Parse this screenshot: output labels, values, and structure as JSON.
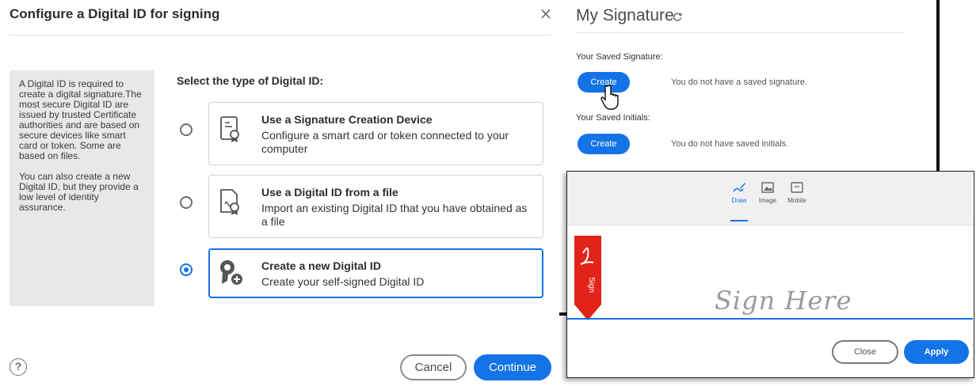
{
  "dialog": {
    "title": "Configure a Digital ID for signing",
    "close_glyph": "×",
    "info_paragraphs": [
      "A Digital ID is required to create a digital signature.The most secure Digital ID are issued by trusted Certificate authorities and are based on secure devices like smart card or token. Some are based on files.",
      "You can also create a new Digital ID, but they provide a low level of identity assurance."
    ],
    "heading": "Select the type of Digital ID:",
    "options": [
      {
        "title": "Use a Signature Creation Device",
        "description": "Configure a smart card or token connected to your computer",
        "icon": "certificate-device-icon",
        "selected": false
      },
      {
        "title": "Use a Digital ID from a file",
        "description": "Import an existing Digital ID that you have obtained as a file",
        "icon": "certificate-file-icon",
        "selected": false
      },
      {
        "title": "Create a new Digital ID",
        "description": "Create your self-signed Digital ID",
        "icon": "badge-add-icon",
        "selected": true
      }
    ],
    "help_glyph": "?",
    "cancel_label": "Cancel",
    "continue_label": "Continue"
  },
  "my_signature": {
    "title": "My Signature",
    "saved_signature_label": "Your Saved Signature:",
    "saved_signature_button": "Create",
    "saved_signature_note": "You do not have a saved signature.",
    "saved_initials_label": "Your Saved Initials:",
    "saved_initials_button": "Create",
    "saved_initials_note": "You do not have saved initials."
  },
  "draw_panel": {
    "tabs": [
      {
        "label": "Draw",
        "icon": "pen-draw-icon",
        "active": true
      },
      {
        "label": "Image",
        "icon": "image-icon",
        "active": false
      },
      {
        "label": "Mobile",
        "icon": "mobile-icon",
        "active": false
      }
    ],
    "flag_text": "Sign",
    "placeholder": "Sign Here",
    "close_label": "Close",
    "apply_label": "Apply"
  },
  "colors": {
    "accent": "#1473e6",
    "panel_gray": "#e8e8e8",
    "flag_red": "#e2231a"
  }
}
